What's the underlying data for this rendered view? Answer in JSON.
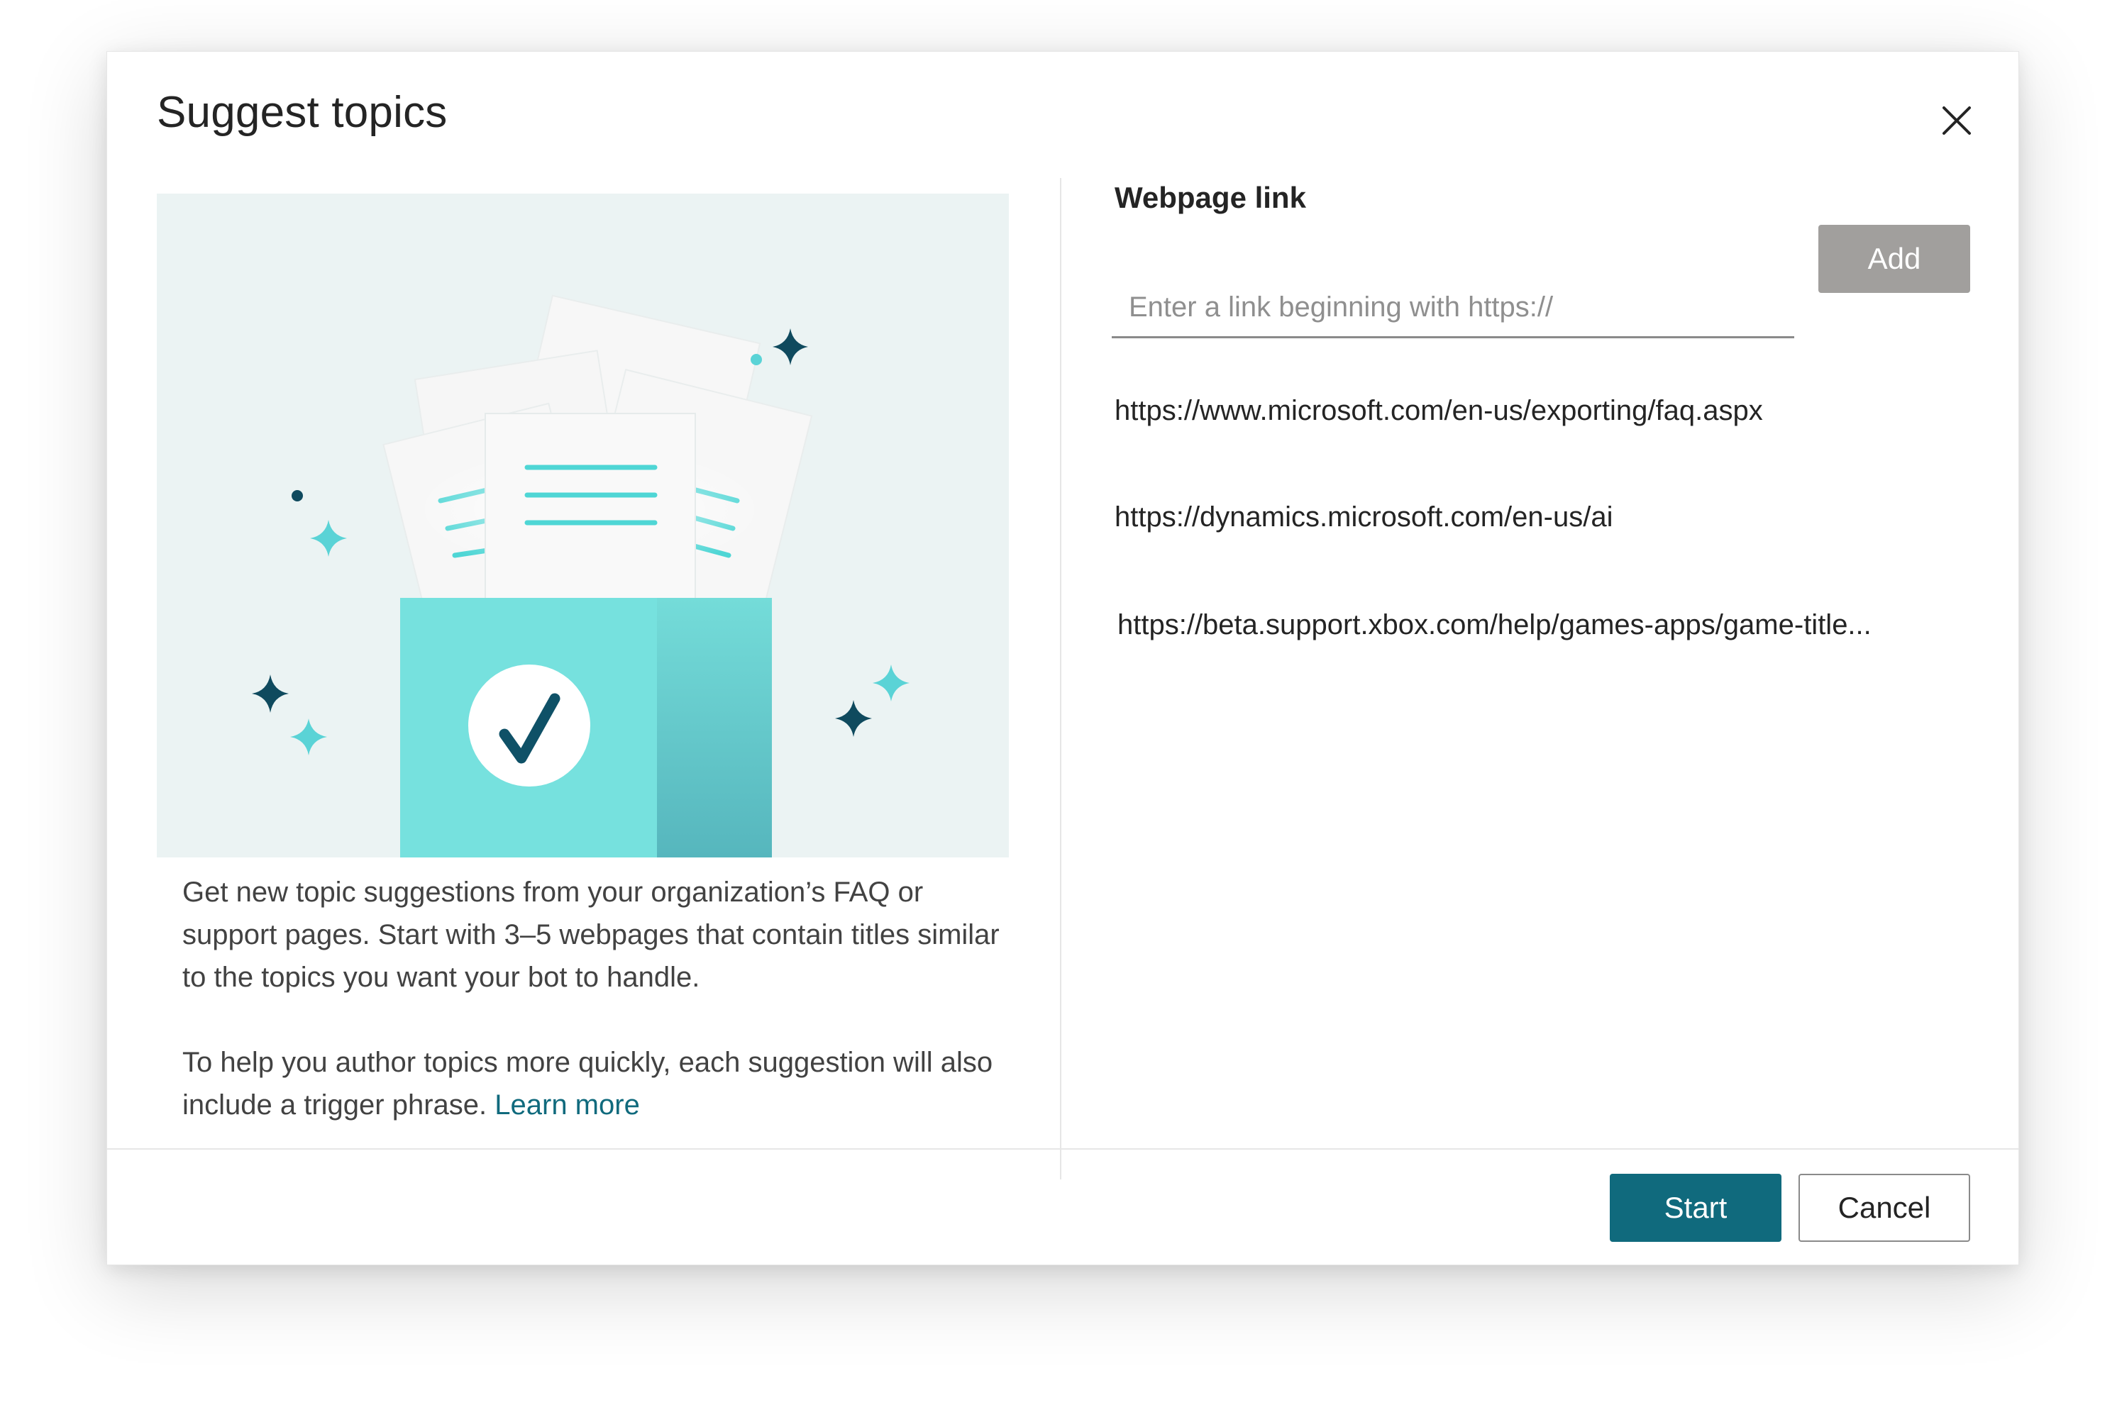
{
  "dialog": {
    "title": "Suggest topics",
    "close_icon": "close-icon"
  },
  "illustration": {
    "icon": "documents-checkmark-illustration",
    "colors": {
      "background": "#ebf3f3",
      "box": "#76e1de",
      "box_side": "#5ab8bf",
      "line": "#4fd6d5",
      "check": "#0f5167",
      "star_dark": "#0f4a5e",
      "star_light": "#5ad3d6"
    }
  },
  "description": {
    "paragraph1": "Get new topic suggestions from your organization’s FAQ or support pages. Start with 3–5 webpages that contain titles similar to the topics you want your bot to handle.",
    "paragraph2": "To help you author topics more quickly, each suggestion will also include a trigger phrase.",
    "learn_more": "Learn more"
  },
  "webpage": {
    "label": "Webpage link",
    "input_value": "",
    "input_placeholder": "Enter a link beginning with https://",
    "add_label": "Add",
    "links": [
      "https://www.microsoft.com/en-us/exporting/faq.aspx",
      "https://dynamics.microsoft.com/en-us/ai",
      "https://beta.support.xbox.com/help/games-apps/game-title..."
    ]
  },
  "footer": {
    "start_label": "Start",
    "cancel_label": "Cancel"
  },
  "colors": {
    "primary": "#106a7d",
    "disabled_button": "#a19f9d"
  }
}
